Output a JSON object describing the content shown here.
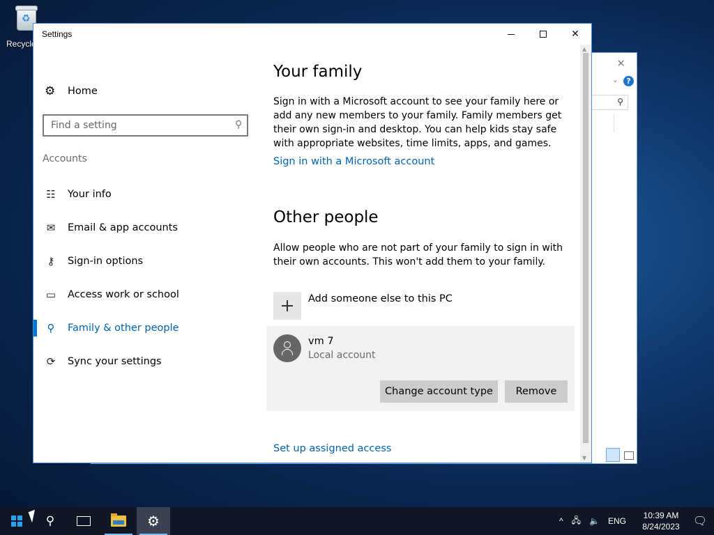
{
  "desktop": {
    "recycle_bin_label": "Recycle"
  },
  "window": {
    "title": "Settings",
    "minimize_icon": "minimize-icon",
    "maximize_icon": "maximize-icon",
    "close_icon": "close-icon"
  },
  "sidebar": {
    "home_label": "Home",
    "search_placeholder": "Find a setting",
    "section_label": "Accounts",
    "items": [
      {
        "label": "Your info",
        "icon": "contact-card-icon",
        "active": false
      },
      {
        "label": "Email & app accounts",
        "icon": "mail-icon",
        "active": false
      },
      {
        "label": "Sign-in options",
        "icon": "key-icon",
        "active": false
      },
      {
        "label": "Access work or school",
        "icon": "briefcase-icon",
        "active": false
      },
      {
        "label": "Family & other people",
        "icon": "person-add-icon",
        "active": true
      },
      {
        "label": "Sync your settings",
        "icon": "sync-icon",
        "active": false
      }
    ]
  },
  "main": {
    "family_heading": "Your family",
    "family_text": "Sign in with a Microsoft account to see your family here or add any new members to your family. Family members get their own sign-in and desktop. You can help kids stay safe with appropriate websites, time limits, apps, and games.",
    "family_link": "Sign in with a Microsoft account",
    "other_heading": "Other people",
    "other_text": "Allow people who are not part of your family to sign in with their own accounts. This won't add them to your family.",
    "add_label": "Add someone else to this PC",
    "account": {
      "name": "vm 7",
      "type": "Local account",
      "change_button": "Change account type",
      "remove_button": "Remove"
    },
    "assigned_access_link": "Set up assigned access"
  },
  "taskbar": {
    "language": "ENG",
    "time": "10:39 AM",
    "date": "8/24/2023"
  },
  "colors": {
    "accent": "#0078d7",
    "link": "#0063b1",
    "taskbar": "#101624"
  }
}
